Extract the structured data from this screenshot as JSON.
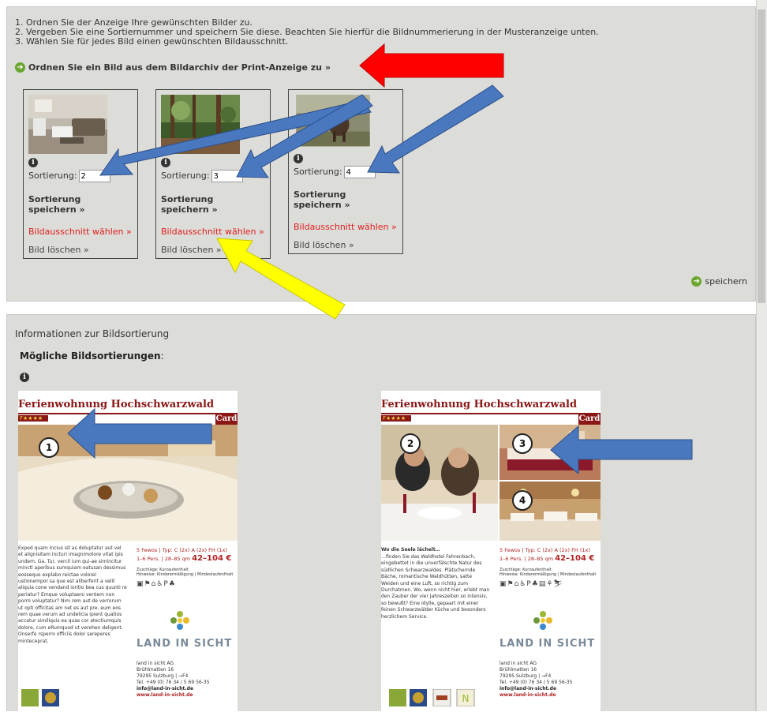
{
  "instructions": [
    "1. Ordnen Sie der Anzeige Ihre gewünschten Bilder zu.",
    "2. Vergeben Sie eine Sortiernummer und speichern Sie diese. Beachten Sie hierfür die Bildnummerierung in der Musteranzeige unten.",
    "3. Wählen Sie für jedes Bild einen gewünschten Bildausschnitt."
  ],
  "assign_link": "Ordnen Sie ein Bild aus dem Bildarchiv der Print-Anzeige zu »",
  "cards": [
    {
      "sort_label": "Sortierung:",
      "sort_value": "2",
      "save_label": "Sortierung speichern »",
      "crop_label": "Bildausschnitt wählen »",
      "delete_label": "Bild löschen »"
    },
    {
      "sort_label": "Sortierung:",
      "sort_value": "3",
      "save_label": "Sortierung speichern »",
      "crop_label": "Bildausschnitt wählen »",
      "delete_label": "Bild löschen »"
    },
    {
      "sort_label": "Sortierung:",
      "sort_value": "4",
      "save_label": "Sortierung speichern »",
      "crop_label": "Bildausschnitt wählen »",
      "delete_label": "Bild löschen »"
    }
  ],
  "save_button": "speichern",
  "info_section": {
    "title": "Informationen zur Bildsortierung",
    "subtitle": "Mögliche Bildsortierungen",
    "subtitle_suffix": ":"
  },
  "sample_docs": [
    {
      "title": "Ferienwohnung Hochschwarzwald",
      "stars": "F★★★★",
      "badge": "Card",
      "numbers": [
        "1"
      ],
      "body": "Exped quam incius sit as doluptatur aut vel et alignisitam incturi imagnimolore vitat ipis undem. Ga. Tur, vercil ium qui-ae simincitur minctl aperibus sumquiam eatusan dessimus eossequo explabo reictae volorel ustionempor sa que est aliberferit a velit aliquia cone vendand ioritio bea cus quunti re periatur? Emque voluptaero ventem non porro voluptatur? Nim rem aut de verrorum ut opti officitas am net es aut pre, eum eos rem quae verum ad undelicia ipient quatios accatur similiquis ea quas cor atectiumquis dolore, cum eRumquod ut verehen deligent. Onserfe rsperro officiis dolor sereperes minteceprat.",
      "price_line1": "5 Fewos | Typ: C (2x) A (2x) FH (1x)",
      "price_line2": "1–6 Pers. | 28–85 qm",
      "price_big": "42–104 €",
      "extras_line1": "Zuschläge: Kurzaufenthalt",
      "extras_line2": "Hinweise: Kinderermäßigung | Mindestaufenthalt",
      "logo": "LAND IN SICHT",
      "address": [
        "land in sicht AG",
        "Brühlmatten 16",
        "79295 Sulzburg | →F4",
        "Tel. +49 (0) 76 34 / 5 69 56-35"
      ],
      "email": "info@land-in-sicht.de",
      "web": "www.land-in-sicht.de"
    },
    {
      "title": "Ferienwohnung Hochschwarzwald",
      "stars": "F★★★★",
      "badge": "Card",
      "numbers": [
        "2",
        "3",
        "4"
      ],
      "headline": "Wo die Seele lächelt…",
      "body": "…finden Sie das Waldhotel Fehrenbach, eingebettet in die unverfälschte Natur des südlichen Schwarzwaldes. Plätschernde Bäche, romantische Waldhütten, satte Weiden und eine Luft, so richtig zum Durchatmen. Wo, wenn nicht hier, erlebt man den Zauber der vier Jahreszeiten so intensiv, so bewußt? Eine Idylle, gepaart mit einer feinen Schwarzwälder Küche und besonders herzlichem Service.",
      "price_line1": "5 Fewos | Typ: C (2x) A (2x) FH (1x)",
      "price_line2": "1–6 Pers. | 28–85 qm",
      "price_big": "42–104 €",
      "extras_line1": "Zuschläge: Kurzaufenthalt",
      "extras_line2": "Hinweise: Kinderermäßigung | Mindestaufenthalt",
      "logo": "LAND IN SICHT",
      "address": [
        "land in sicht AG",
        "Brühlmatten 16",
        "79295 Sulzburg | →F4",
        "Tel. +49 (0) 76 34 / 5 69 56-35"
      ],
      "email": "info@land-in-sicht.de",
      "web": "www.land-in-sicht.de"
    }
  ],
  "colors": {
    "panel_bg": "#dcdcd8",
    "link_red": "#e02020",
    "doc_accent": "#8a1616",
    "annotation_blue": "#4a78bf",
    "annotation_red": "#ff0000",
    "annotation_yellow": "#ffff00",
    "green_icon": "#6aa52f"
  }
}
